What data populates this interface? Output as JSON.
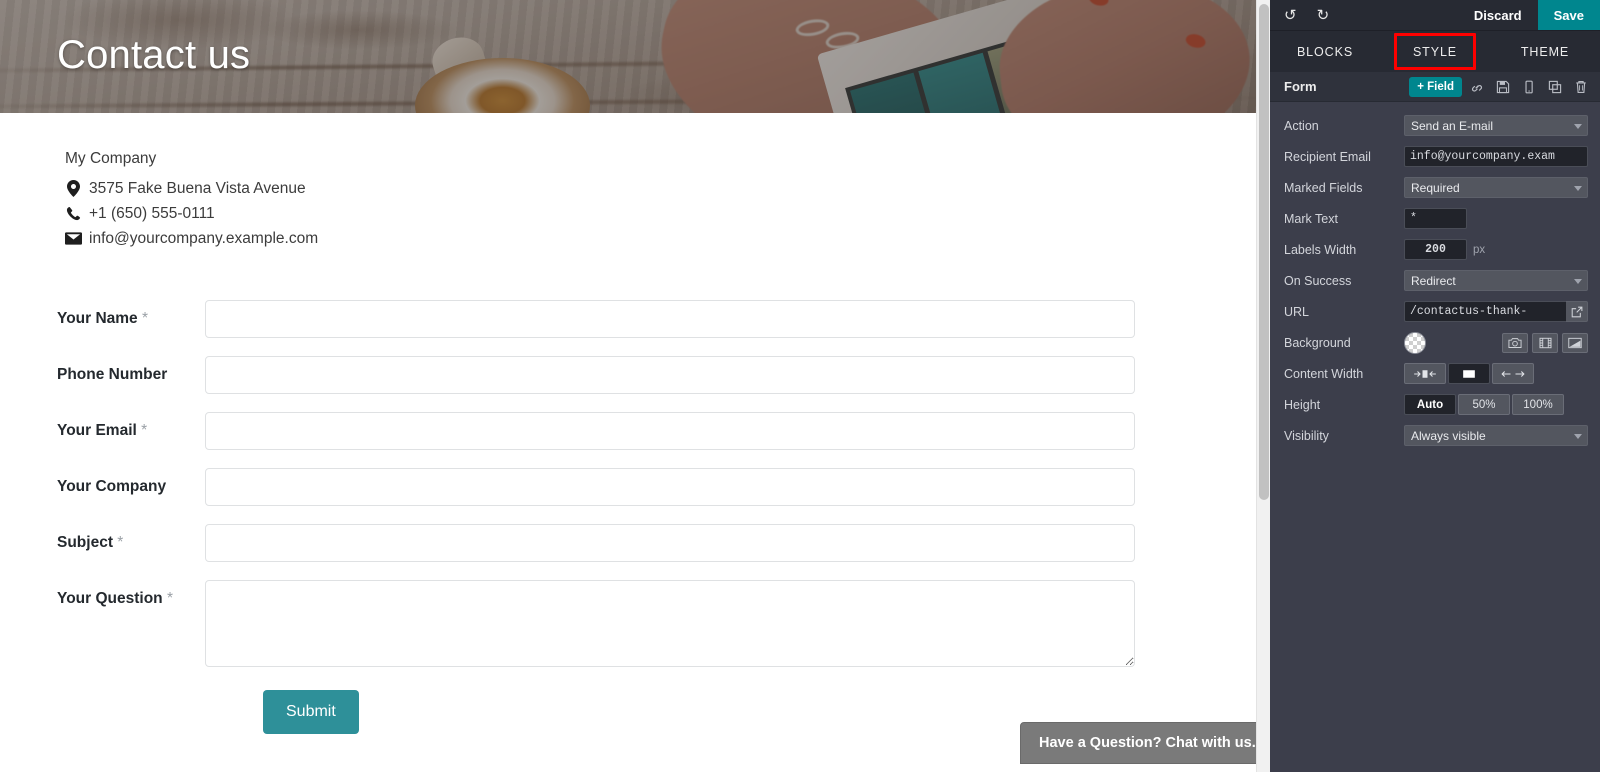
{
  "website": {
    "hero_title": "Contact us",
    "contact": {
      "company": "My Company",
      "address": "3575 Fake Buena Vista Avenue",
      "phone": "+1 (650) 555-0111",
      "email": "info@yourcompany.example.com",
      "icons": {
        "address": "map-pin-icon",
        "phone": "phone-icon",
        "email": "envelope-icon"
      }
    },
    "form": {
      "fields": [
        {
          "label": "Your Name",
          "mark": "*",
          "value": "",
          "type": "text"
        },
        {
          "label": "Phone Number",
          "mark": "",
          "value": "",
          "type": "text"
        },
        {
          "label": "Your Email",
          "mark": "*",
          "value": "",
          "type": "text"
        },
        {
          "label": "Your Company",
          "mark": "",
          "value": "",
          "type": "text"
        },
        {
          "label": "Subject",
          "mark": "*",
          "value": "",
          "type": "text"
        },
        {
          "label": "Your Question",
          "mark": "*",
          "value": "",
          "type": "textarea"
        }
      ],
      "submit_label": "Submit",
      "submit_color": "#2e9099"
    },
    "chat_bubble": "Have a Question? Chat with us."
  },
  "editor": {
    "topbar": {
      "undo_icon": "undo-icon",
      "redo_icon": "redo-icon",
      "undo_glyph": "↺",
      "redo_glyph": "↻",
      "discard_label": "Discard",
      "save_label": "Save",
      "save_color": "#00868e"
    },
    "tabs": [
      {
        "label": "BLOCKS",
        "active": false
      },
      {
        "label": "STYLE",
        "active": true
      },
      {
        "label": "THEME",
        "active": false
      }
    ],
    "highlight_color": "#ff0000",
    "block": {
      "title": "Form",
      "add_field_label": "+ Field",
      "icons": [
        "link-icon",
        "save-floppy-icon",
        "mobile-icon",
        "duplicate-icon",
        "trash-icon"
      ]
    },
    "options": [
      {
        "label": "Action",
        "control": "select",
        "value": "Send an E-mail"
      },
      {
        "label": "Recipient Email",
        "control": "text",
        "value": "info@yourcompany.exam"
      },
      {
        "label": "Marked Fields",
        "control": "select",
        "value": "Required"
      },
      {
        "label": "Mark Text",
        "control": "short",
        "value": "*"
      },
      {
        "label": "Labels Width",
        "control": "number",
        "value": "200",
        "unit": "px"
      },
      {
        "label": "On Success",
        "control": "select",
        "value": "Redirect"
      },
      {
        "label": "URL",
        "control": "url",
        "value": "/contactus-thank-",
        "open_icon": "external-link-icon"
      },
      {
        "label": "Background",
        "control": "background",
        "swatch": "transparent",
        "buttons": [
          "camera-icon",
          "video-icon",
          "gradient-icon"
        ]
      },
      {
        "label": "Content Width",
        "control": "segments",
        "segments": [
          {
            "icon": "narrow-width-icon",
            "active": false
          },
          {
            "icon": "medium-width-icon",
            "active": true
          },
          {
            "icon": "full-width-icon",
            "active": false
          }
        ]
      },
      {
        "label": "Height",
        "control": "segments-text",
        "segments": [
          {
            "label": "Auto",
            "active": true
          },
          {
            "label": "50%",
            "active": false
          },
          {
            "label": "100%",
            "active": false
          }
        ]
      },
      {
        "label": "Visibility",
        "control": "select",
        "value": "Always visible"
      }
    ]
  }
}
